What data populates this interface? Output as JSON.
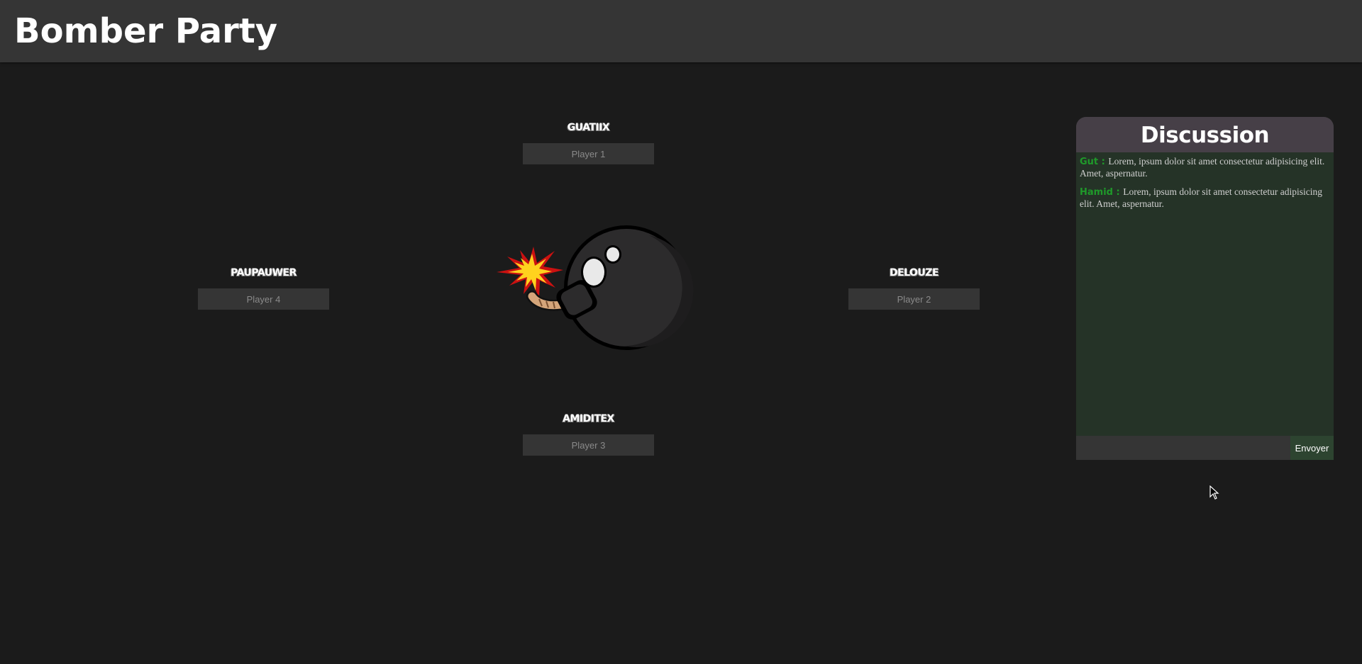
{
  "app": {
    "title": "Bomber Party"
  },
  "players": {
    "p1": {
      "name": "GUATIIX",
      "placeholder": "Player 1"
    },
    "p2": {
      "name": "DELOUZE",
      "placeholder": "Player 2"
    },
    "p3": {
      "name": "AMIDITEX",
      "placeholder": "Player 3"
    },
    "p4": {
      "name": "PAUPAUWER",
      "placeholder": "Player 4"
    }
  },
  "chat": {
    "title": "Discussion",
    "messages": [
      {
        "author": "Gut : ",
        "text": "Lorem, ipsum dolor sit amet consectetur adipisicing elit. Amet, aspernatur."
      },
      {
        "author": "Hamid : ",
        "text": "Lorem, ipsum dolor sit amet consectetur adipisicing elit. Amet, aspernatur."
      }
    ],
    "input_value": "",
    "send_label": "Envoyer"
  },
  "colors": {
    "background": "#1b1b1b",
    "header": "#353535",
    "chat_header": "#463f47",
    "chat_body": "#253327",
    "author_green": "#1f9a2a",
    "send_button": "#2d4430"
  },
  "icons": {
    "bomb": "bomb-icon",
    "cursor": "mouse-cursor-icon"
  }
}
